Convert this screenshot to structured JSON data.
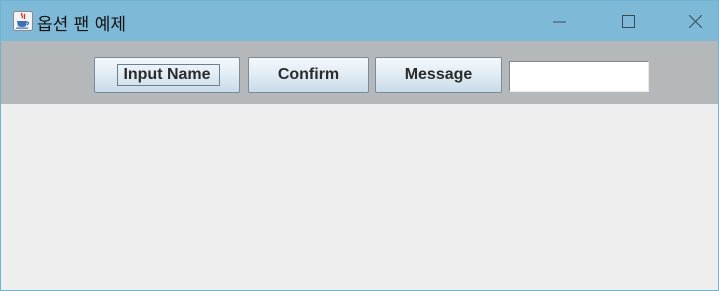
{
  "window": {
    "title": "옵션 팬 예제",
    "app_icon": "java-coffee-cup-icon",
    "controls": [
      "minimize-icon",
      "maximize-icon",
      "close-icon"
    ]
  },
  "toolbar": {
    "input_name_label": "Input Name",
    "confirm_label": "Confirm",
    "message_label": "Message",
    "text_field_value": ""
  },
  "colors": {
    "titlebar": "#7ebad8",
    "toolbar": "#b4b8bb",
    "content": "#eeeeee"
  }
}
